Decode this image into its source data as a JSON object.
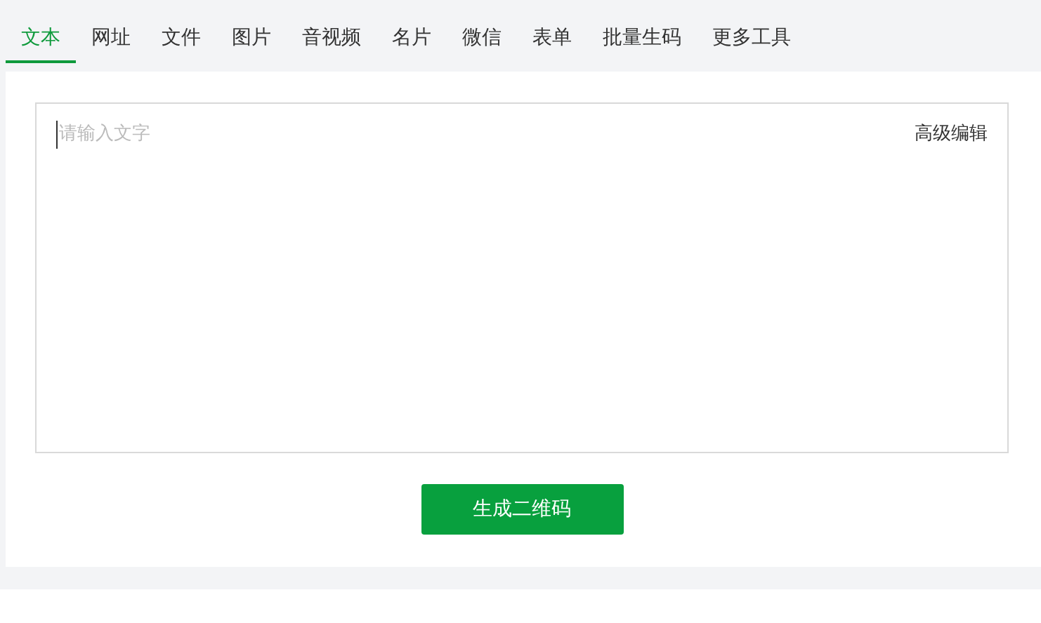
{
  "tabs": [
    {
      "label": "文本",
      "selected": true
    },
    {
      "label": "网址",
      "selected": false
    },
    {
      "label": "文件",
      "selected": false
    },
    {
      "label": "图片",
      "selected": false
    },
    {
      "label": "音视频",
      "selected": false
    },
    {
      "label": "名片",
      "selected": false
    },
    {
      "label": "微信",
      "selected": false
    },
    {
      "label": "表单",
      "selected": false
    },
    {
      "label": "批量生码",
      "selected": false
    },
    {
      "label": "更多工具",
      "selected": false
    }
  ],
  "editor": {
    "placeholder": "请输入文字",
    "advanced_edit": "高级编辑"
  },
  "generate_button": "生成二维码"
}
